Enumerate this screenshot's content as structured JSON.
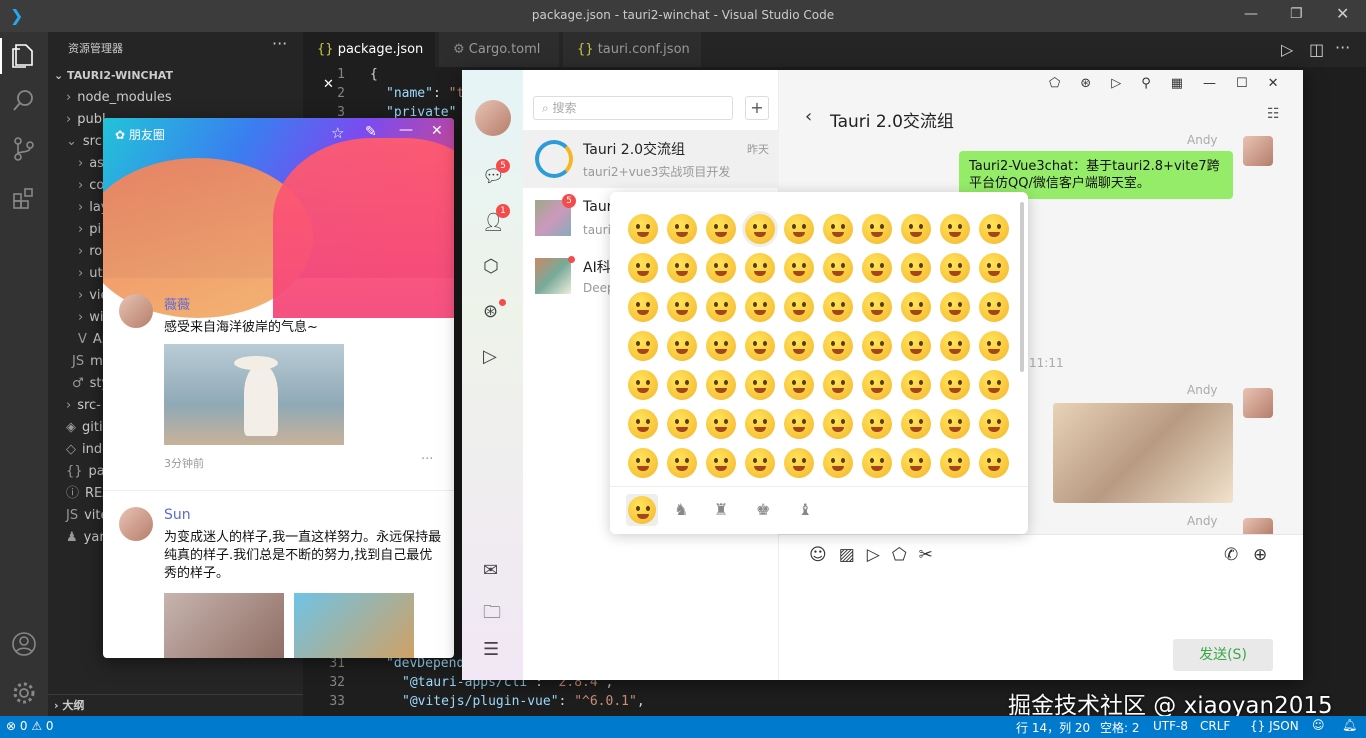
{
  "window": {
    "title": "package.json - tauri2-winchat - Visual Studio Code"
  },
  "sidebar": {
    "header": "资源管理器",
    "project": "TAURI2-WINCHAT",
    "items": [
      "node_modules",
      "publ",
      "src",
      "as",
      "co",
      "lay",
      "pi",
      "ro",
      "ut",
      "vie",
      "wi",
      "Ap",
      "ma",
      "sty",
      "src-",
      "giti",
      "inde",
      "pac",
      "REA",
      "vite",
      "yarn"
    ],
    "outline": "大纲"
  },
  "tabs": [
    {
      "label": "package.json"
    },
    {
      "label": "Cargo.toml"
    },
    {
      "label": "tauri.conf.json"
    }
  ],
  "code": {
    "line1": "1",
    "line2": "2",
    "line3": "3",
    "line31": "31",
    "line32": "32",
    "line33": "33",
    "brace": "{",
    "name_key": "\"name\"",
    "name_val": "\"t",
    "private_key": "\"private\"",
    "devdeps": "\"devDepend",
    "tauri_cli": "\"@tauri-apps/cli\"",
    "tauri_cli_v": "\"2.8.4\"",
    "vite_vue": "\"@vitejs/plugin-vue\"",
    "vite_vue_v": "\"^6.0.1\""
  },
  "status": {
    "errors": "0",
    "warnings": "0",
    "position": "行 14，列 20",
    "spaces": "空格: 2",
    "encoding": "UTF-8",
    "eol": "CRLF",
    "lang": "JSON"
  },
  "watermark": "掘金技术社区 @ xiaoyan2015",
  "moments": {
    "title": "朋友圈",
    "posts": [
      {
        "name": "薇薇",
        "text": "感受来自海洋彼岸的气息~",
        "time": "3分钟前"
      },
      {
        "name": "Sun",
        "text": "为变成迷人的样子,我一直这样努力。永远保持最纯真的样子.我们总是不断的努力,找到自己最优秀的样子。"
      }
    ]
  },
  "chat": {
    "search_placeholder": "搜索",
    "nav_badges": {
      "chat": "5",
      "contacts": "1"
    },
    "list": [
      {
        "name": "Tauri 2.0交流组",
        "preview": "tauri2+vue3实战项目开发",
        "time": "昨天"
      },
      {
        "name": "Taur",
        "preview": "tauri2",
        "badge": "5"
      },
      {
        "name": "AI科",
        "preview": "Deep"
      }
    ],
    "header": "Tauri 2.0交流组",
    "messages": [
      {
        "sender": "Andy",
        "text": "Tauri2-Vue3chat：基于tauri2.8+vite7跨平台仿QQ/微信客户端聊天室。"
      },
      {
        "sender": "Andy",
        "type": "image"
      },
      {
        "sender": "Andy"
      }
    ],
    "time_stamp": "11:11",
    "send_label": "发送(S)"
  },
  "colors": {
    "statusbar": "#007acc",
    "bubble": "#95ec69",
    "accent": "#5b6ad8"
  }
}
